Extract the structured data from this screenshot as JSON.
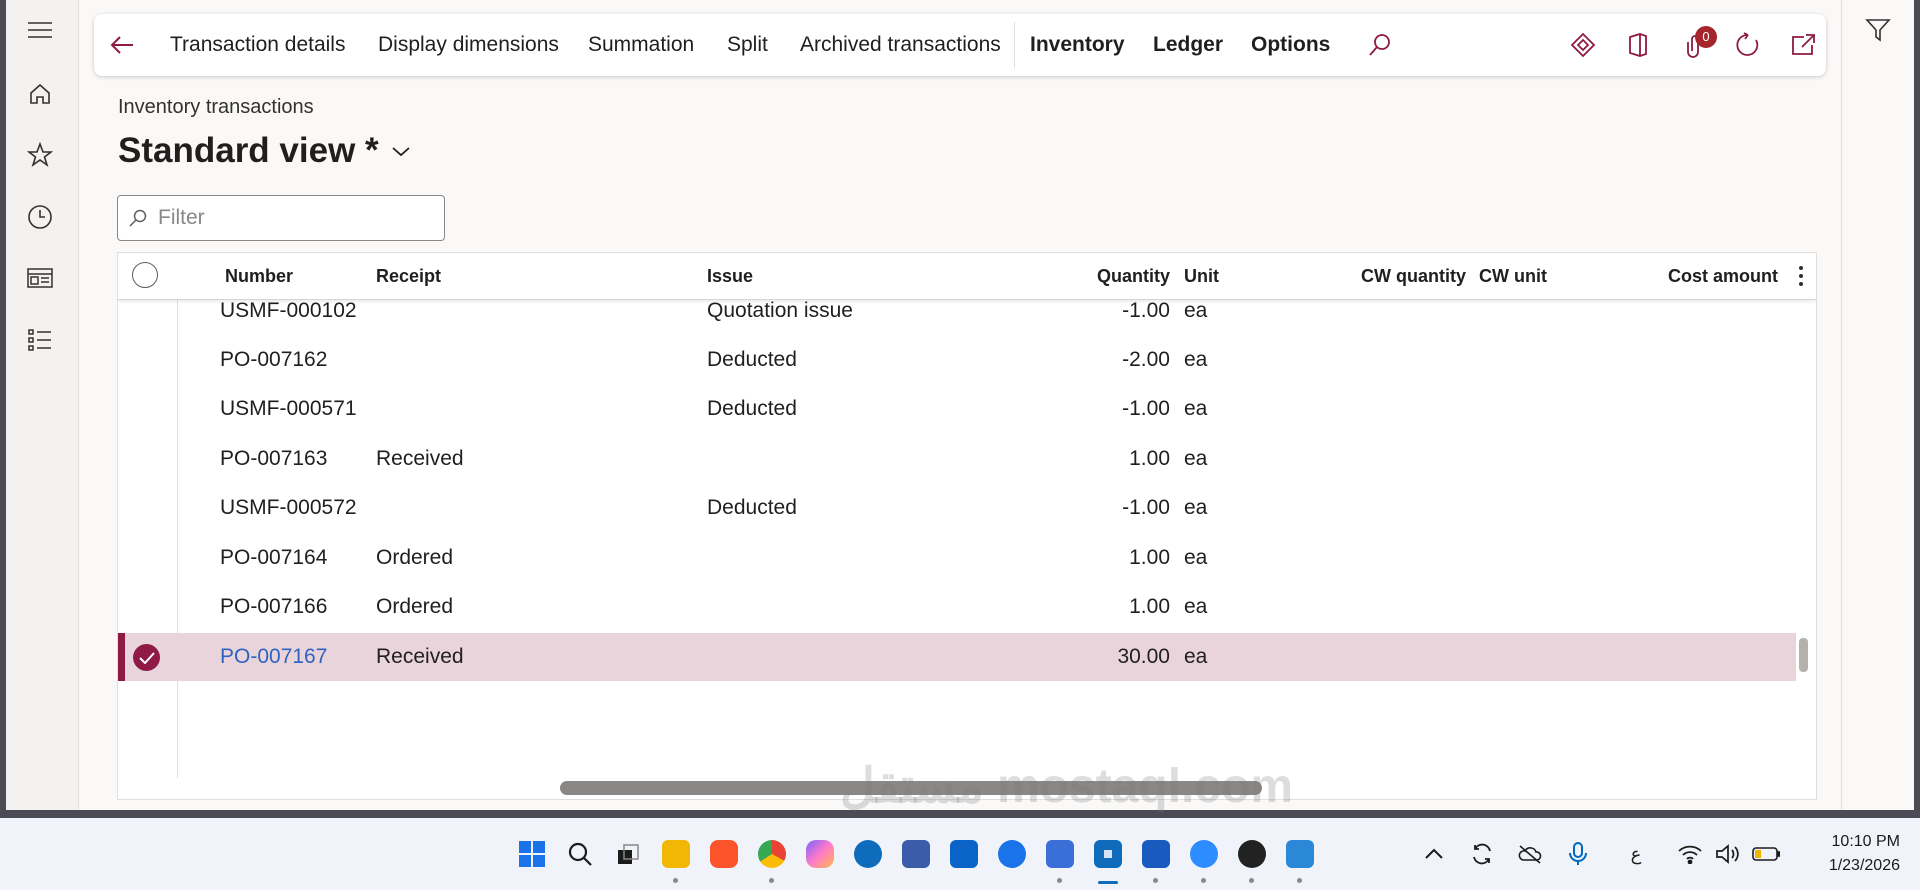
{
  "toolbar": {
    "items": [
      "Transaction details",
      "Display dimensions",
      "Summation",
      "Split",
      "Archived transactions"
    ],
    "bold_items": [
      "Inventory",
      "Ledger",
      "Options"
    ],
    "notification_count": "0"
  },
  "page": {
    "breadcrumb": "Inventory transactions",
    "view_title": "Standard view *"
  },
  "filter": {
    "placeholder": "Filter",
    "value": ""
  },
  "grid": {
    "columns": [
      "Number",
      "Receipt",
      "Issue",
      "Quantity",
      "Unit",
      "CW quantity",
      "CW unit",
      "Cost amount"
    ],
    "rows": [
      {
        "number": "USMF-000102",
        "receipt": "",
        "issue": "Quotation issue",
        "quantity": "-1.00",
        "unit": "ea"
      },
      {
        "number": "PO-007162",
        "receipt": "",
        "issue": "Deducted",
        "quantity": "-2.00",
        "unit": "ea"
      },
      {
        "number": "USMF-000571",
        "receipt": "",
        "issue": "Deducted",
        "quantity": "-1.00",
        "unit": "ea"
      },
      {
        "number": "PO-007163",
        "receipt": "Received",
        "issue": "",
        "quantity": "1.00",
        "unit": "ea"
      },
      {
        "number": "USMF-000572",
        "receipt": "",
        "issue": "Deducted",
        "quantity": "-1.00",
        "unit": "ea"
      },
      {
        "number": "PO-007164",
        "receipt": "Ordered",
        "issue": "",
        "quantity": "1.00",
        "unit": "ea"
      },
      {
        "number": "PO-007166",
        "receipt": "Ordered",
        "issue": "",
        "quantity": "1.00",
        "unit": "ea"
      },
      {
        "number": "PO-007167",
        "receipt": "Received",
        "issue": "",
        "quantity": "30.00",
        "unit": "ea",
        "selected": true
      }
    ]
  },
  "taskbar": {
    "time": "10:10 PM",
    "date": "1/23/2026",
    "input_lang": "ع",
    "watermark": "مستقل mostaql.com"
  },
  "colors": {
    "accent": "#8e1a45",
    "selected_row": "#ead4db",
    "link": "#2f63c0"
  }
}
